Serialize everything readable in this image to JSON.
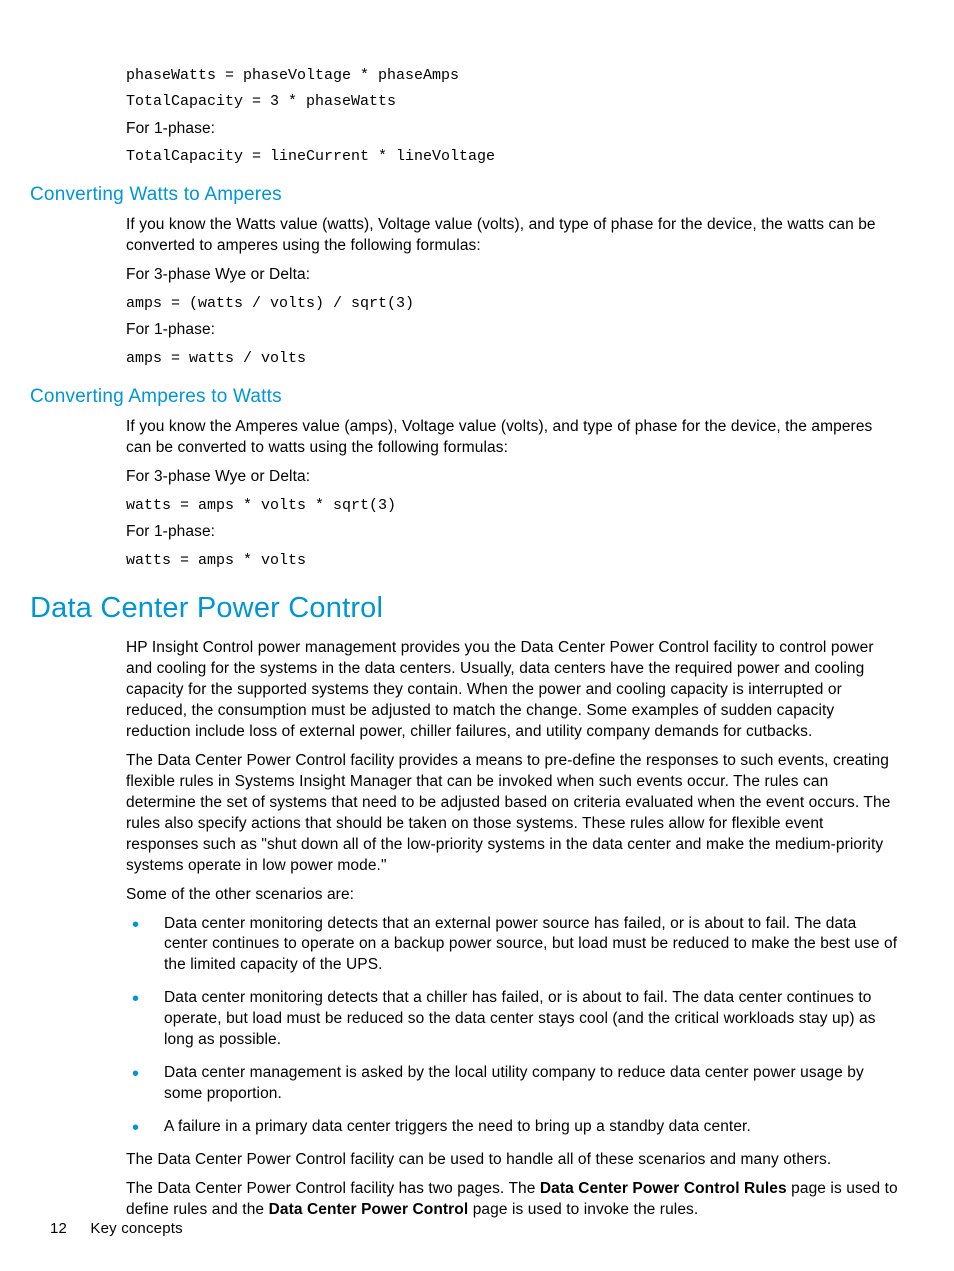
{
  "intro": {
    "code1": "phaseWatts = phaseVoltage * phaseAmps",
    "code2": "TotalCapacity = 3 * phaseWatts",
    "line1": "For 1-phase:",
    "code3": "TotalCapacity = lineCurrent * lineVoltage"
  },
  "sec1": {
    "heading": "Converting Watts to Amperes",
    "p1": "If you know the Watts value (watts), Voltage value (volts), and type of phase for the device, the watts can be converted to amperes using the following formulas:",
    "l1": "For 3-phase Wye or Delta:",
    "c1": "amps = (watts / volts) / sqrt(3)",
    "l2": "For 1-phase:",
    "c2": "amps = watts / volts"
  },
  "sec2": {
    "heading": "Converting Amperes to Watts",
    "p1": "If you know the Amperes value (amps), Voltage value (volts), and type of phase for the device, the amperes can be converted to watts using the following formulas:",
    "l1": "For 3-phase Wye or Delta:",
    "c1": "watts = amps * volts * sqrt(3)",
    "l2": "For 1-phase:",
    "c2": "watts = amps * volts"
  },
  "sec3": {
    "heading": "Data Center Power Control",
    "p1": "HP Insight Control power management provides you the Data Center Power Control facility to control power and cooling for the systems in the data centers. Usually, data centers have the required power and cooling capacity for the supported systems they contain. When the power and cooling capacity is interrupted or reduced, the consumption must be adjusted to match the change. Some examples of sudden capacity reduction include loss of external power, chiller failures, and utility company demands for cutbacks.",
    "p2": "The Data Center Power Control facility provides a means to pre-define the responses to such events, creating flexible rules in Systems Insight Manager that can be invoked when such events occur. The rules can determine the set of systems that need to be adjusted based on criteria evaluated when the event occurs. The rules also specify actions that should be taken on those systems. These rules allow for flexible event responses such as \"shut down all of the low-priority systems in the data center and make the medium-priority systems operate in low power mode.\"",
    "p3": "Some of the other scenarios are:",
    "bullets": [
      "Data center monitoring detects that an external power source has failed, or is about to fail. The data center continues to operate on a backup power source, but load must be reduced to make the best use of the limited capacity of the UPS.",
      "Data center monitoring detects that a chiller has failed, or is about to fail. The data center continues to operate, but load must be reduced so the data center stays cool (and the critical workloads stay up) as long as possible.",
      "Data center management is asked by the local utility company to reduce data center power usage by some proportion.",
      "A failure in a primary data center triggers the need to bring up a standby data center."
    ],
    "p4": "The Data Center Power Control facility can be used to handle all of these scenarios and many others.",
    "p5_a": "The Data Center Power Control facility has two pages. The ",
    "p5_b1": "Data Center Power Control Rules",
    "p5_c": " page is used to define rules and the ",
    "p5_b2": "Data Center Power Control",
    "p5_d": " page is used to invoke the rules."
  },
  "footer": {
    "page": "12",
    "title": "Key concepts"
  }
}
